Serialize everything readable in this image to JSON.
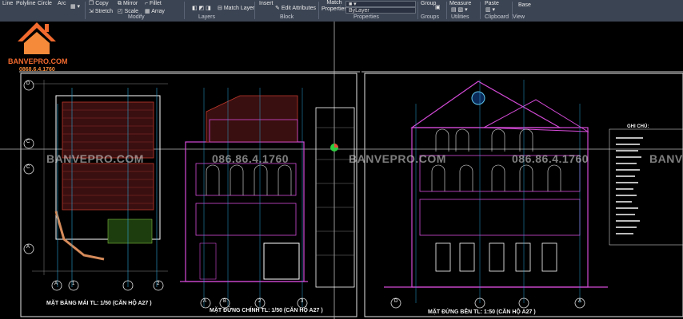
{
  "ribbon": {
    "draw": {
      "line": "Line",
      "polyline": "Polyline",
      "circle": "Circle",
      "arc": "Arc"
    },
    "modify": {
      "copy": "Copy",
      "mirror": "Mirror",
      "fillet": "Fillet",
      "stretch": "Stretch",
      "scale": "Scale",
      "array": "Array",
      "panel": "Modify"
    },
    "layers": {
      "match_layer": "Match Layer",
      "panel": "Layers"
    },
    "block": {
      "insert": "Insert",
      "edit_attributes": "Edit Attributes",
      "panel": "Block"
    },
    "properties": {
      "match": "Match",
      "match2": "Properties",
      "bylayer": "ByLayer",
      "panel": "Properties"
    },
    "groups": {
      "group": "Group",
      "panel": "Groups"
    },
    "utilities": {
      "measure": "Measure",
      "panel": "Utilities"
    },
    "clipboard": {
      "paste": "Paste",
      "panel": "Clipboard"
    },
    "view": {
      "base": "Base",
      "panel": "View"
    }
  },
  "logo": {
    "brand": "BANVEPRO.COM",
    "phone": "0868.6.4.1760"
  },
  "watermarks": {
    "site": "BANVEPRO.COM",
    "phone": "086.86.4.1760"
  },
  "captions": {
    "roof_plan": "MẶT BẰNG MÁI TL: 1/50 (CĂN HỘ A27 )",
    "front_elev": "MẶT ĐỨNG CHÍNH TL: 1/50 (CĂN HỘ A27 )",
    "side_elev": "MẶT ĐỨNG BÊN TL: 1:50 (CĂN HỘ A27 )",
    "notes_title": "GHI CHÚ:"
  },
  "grid_labels": {
    "D": "D",
    "C": "C",
    "B": "B",
    "A": "A",
    "one": "1",
    "two": "2",
    "three": "3"
  }
}
